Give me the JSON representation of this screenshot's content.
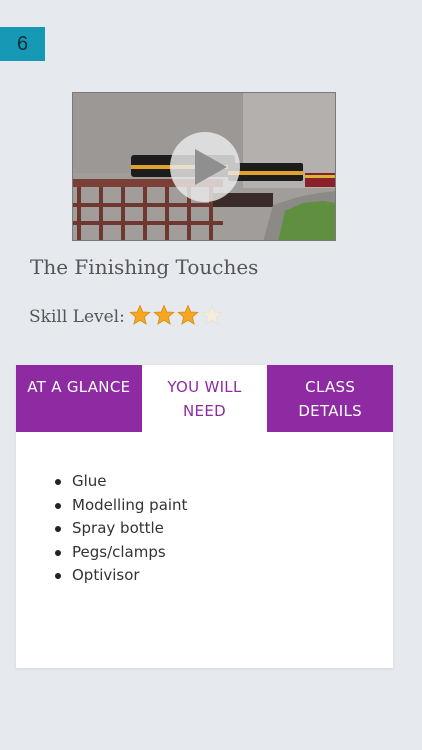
{
  "page_number": "6",
  "lesson": {
    "title": "The Finishing Touches",
    "skill_label": "Skill Level:",
    "skill_rating": 3,
    "skill_max": 4
  },
  "tabs": [
    {
      "label": "AT A GLANCE",
      "active": false
    },
    {
      "label": "YOU WILL NEED",
      "active": true
    },
    {
      "label": "CLASS DETAILS",
      "active": false
    }
  ],
  "you_will_need": [
    "Glue",
    "Modelling paint",
    "Spray bottle",
    "Pegs/clamps",
    "Optivisor"
  ],
  "colors": {
    "accent": "#8e2ba2",
    "badge": "#1699b5",
    "star_filled": "#f5a623",
    "star_empty": "#f3ede0"
  }
}
